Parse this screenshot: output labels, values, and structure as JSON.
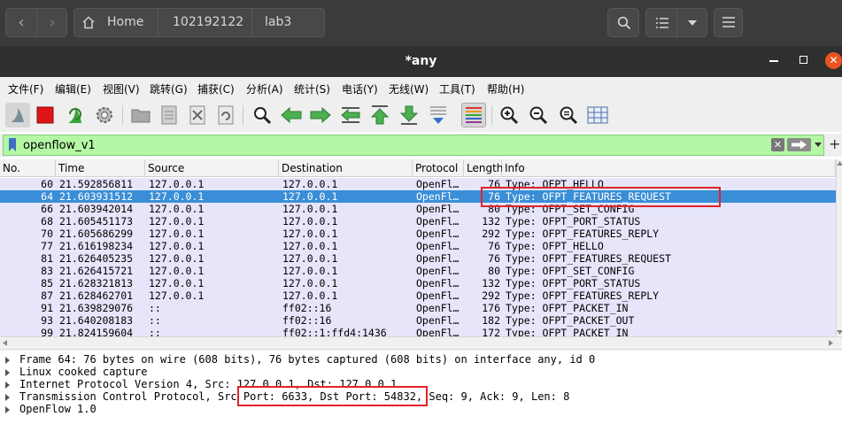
{
  "filemanager": {
    "breadcrumb": [
      "Home",
      "102192122",
      "lab3"
    ]
  },
  "window": {
    "title": "*any"
  },
  "menu": [
    "文件(F)",
    "编辑(E)",
    "视图(V)",
    "跳转(G)",
    "捕获(C)",
    "分析(A)",
    "统计(S)",
    "电话(Y)",
    "无线(W)",
    "工具(T)",
    "帮助(H)"
  ],
  "toolbar_icons": [
    "shark-fin-start-icon",
    "stop-capture-icon",
    "restart-capture-icon",
    "capture-options-icon",
    "open-file-icon",
    "save-file-icon",
    "close-file-icon",
    "reload-file-icon",
    "find-packet-icon",
    "go-back-icon",
    "go-forward-icon",
    "go-to-packet-icon",
    "go-first-icon",
    "go-last-icon",
    "autoscroll-icon",
    "colorize-icon",
    "zoom-in-icon",
    "zoom-out-icon",
    "zoom-normal-icon",
    "resize-columns-icon"
  ],
  "filter": {
    "value": "openflow_v1"
  },
  "packet_list": {
    "columns": [
      "No.",
      "Time",
      "Source",
      "Destination",
      "Protocol",
      "Length",
      "Info"
    ],
    "rows": [
      {
        "no": "60",
        "time": "21.592856811",
        "src": "127.0.0.1",
        "dst": "127.0.0.1",
        "proto": "OpenFl…",
        "len": "76",
        "info": "Type: OFPT_HELLO",
        "selected": false
      },
      {
        "no": "64",
        "time": "21.603931512",
        "src": "127.0.0.1",
        "dst": "127.0.0.1",
        "proto": "OpenFl…",
        "len": "76",
        "info": "Type: OFPT_FEATURES_REQUEST",
        "selected": true
      },
      {
        "no": "66",
        "time": "21.603942014",
        "src": "127.0.0.1",
        "dst": "127.0.0.1",
        "proto": "OpenFl…",
        "len": "80",
        "info": "Type: OFPT_SET_CONFIG",
        "selected": false
      },
      {
        "no": "68",
        "time": "21.605451173",
        "src": "127.0.0.1",
        "dst": "127.0.0.1",
        "proto": "OpenFl…",
        "len": "132",
        "info": "Type: OFPT_PORT_STATUS",
        "selected": false
      },
      {
        "no": "70",
        "time": "21.605686299",
        "src": "127.0.0.1",
        "dst": "127.0.0.1",
        "proto": "OpenFl…",
        "len": "292",
        "info": "Type: OFPT_FEATURES_REPLY",
        "selected": false
      },
      {
        "no": "77",
        "time": "21.616198234",
        "src": "127.0.0.1",
        "dst": "127.0.0.1",
        "proto": "OpenFl…",
        "len": "76",
        "info": "Type: OFPT_HELLO",
        "selected": false
      },
      {
        "no": "81",
        "time": "21.626405235",
        "src": "127.0.0.1",
        "dst": "127.0.0.1",
        "proto": "OpenFl…",
        "len": "76",
        "info": "Type: OFPT_FEATURES_REQUEST",
        "selected": false
      },
      {
        "no": "83",
        "time": "21.626415721",
        "src": "127.0.0.1",
        "dst": "127.0.0.1",
        "proto": "OpenFl…",
        "len": "80",
        "info": "Type: OFPT_SET_CONFIG",
        "selected": false
      },
      {
        "no": "85",
        "time": "21.628321813",
        "src": "127.0.0.1",
        "dst": "127.0.0.1",
        "proto": "OpenFl…",
        "len": "132",
        "info": "Type: OFPT_PORT_STATUS",
        "selected": false
      },
      {
        "no": "87",
        "time": "21.628462701",
        "src": "127.0.0.1",
        "dst": "127.0.0.1",
        "proto": "OpenFl…",
        "len": "292",
        "info": "Type: OFPT_FEATURES_REPLY",
        "selected": false
      },
      {
        "no": "91",
        "time": "21.639829076",
        "src": "::",
        "dst": "ff02::16",
        "proto": "OpenFl…",
        "len": "176",
        "info": "Type: OFPT_PACKET_IN",
        "selected": false
      },
      {
        "no": "93",
        "time": "21.640208183",
        "src": "::",
        "dst": "ff02::16",
        "proto": "OpenFl…",
        "len": "182",
        "info": "Type: OFPT_PACKET_OUT",
        "selected": false
      },
      {
        "no": "99",
        "time": "21.824159604",
        "src": "::",
        "dst": "ff02::1:ffd4:1436",
        "proto": "OpenFl…",
        "len": "172",
        "info": "Type: OFPT_PACKET_IN",
        "selected": false
      }
    ]
  },
  "details": [
    "Frame 64: 76 bytes on wire (608 bits), 76 bytes captured (608 bits) on interface any, id 0",
    "Linux cooked capture",
    "Internet Protocol Version 4, Src: 127.0.0.1, Dst: 127.0.0.1",
    "Transmission Control Protocol, Src Port: 6633, Dst Port: 54832, Seq: 9, Ack: 9, Len: 8",
    "OpenFlow 1.0"
  ],
  "colors": {
    "row_bg": "#e6e5fa",
    "selected_bg": "#3a8ed7",
    "filter_bg": "#b4f7a4",
    "annotation": "#e0242a"
  }
}
